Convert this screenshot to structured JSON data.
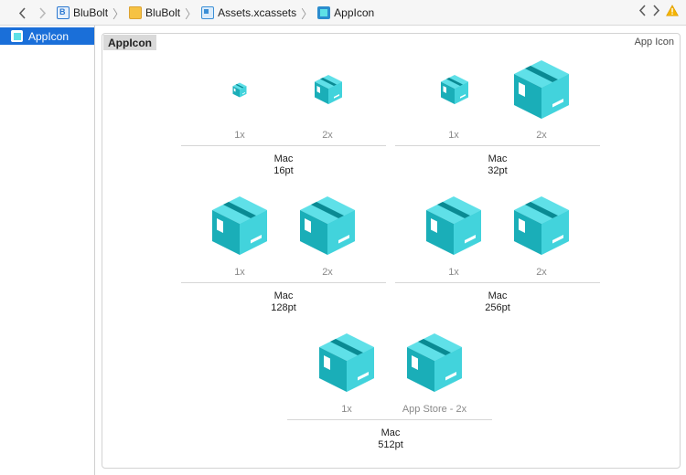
{
  "toolbar": {
    "back_icon": "chevron-left-icon",
    "forward_icon": "chevron-right-icon",
    "breadcrumbs": [
      {
        "label": "BluBolt",
        "icon": "project-file-icon"
      },
      {
        "label": "BluBolt",
        "icon": "folder-icon"
      },
      {
        "label": "Assets.xcassets",
        "icon": "asset-catalog-icon"
      },
      {
        "label": "AppIcon",
        "icon": "appicon-set-icon"
      }
    ],
    "right_icons": [
      "chevron-left-icon",
      "chevron-right-icon",
      "warning-icon"
    ],
    "warning_color": "#f5b400"
  },
  "sidebar": {
    "items": [
      {
        "label": "AppIcon",
        "selected": true,
        "icon": "appicon-set-icon"
      }
    ],
    "selection_color": "#1a6fd9"
  },
  "panel": {
    "title": "AppIcon",
    "type_label": "App Icon",
    "groups": [
      {
        "platform": "Mac",
        "size": "16pt",
        "slots": [
          {
            "scale": "1x"
          },
          {
            "scale": "2x"
          }
        ]
      },
      {
        "platform": "Mac",
        "size": "32pt",
        "slots": [
          {
            "scale": "1x"
          },
          {
            "scale": "2x"
          }
        ]
      },
      {
        "platform": "Mac",
        "size": "128pt",
        "slots": [
          {
            "scale": "1x"
          },
          {
            "scale": "2x"
          }
        ]
      },
      {
        "platform": "Mac",
        "size": "256pt",
        "slots": [
          {
            "scale": "1x"
          },
          {
            "scale": "2x"
          }
        ]
      },
      {
        "platform": "Mac",
        "size": "512pt",
        "slots": [
          {
            "scale": "1x"
          },
          {
            "scale": "App Store - 2x"
          }
        ]
      }
    ]
  },
  "icon_colors": {
    "top": "#5fe0e8",
    "left": "#1aaeb8",
    "right": "#0e97a0",
    "stripe": "#0a8a93"
  }
}
